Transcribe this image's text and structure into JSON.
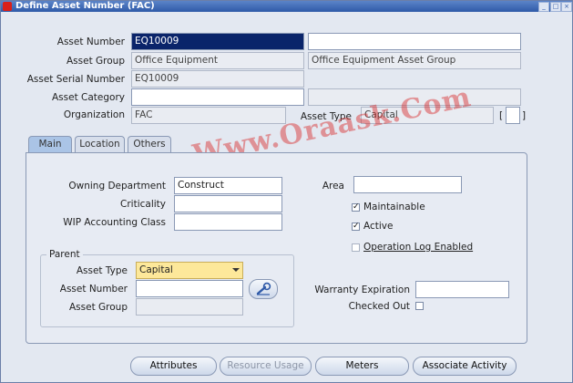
{
  "window": {
    "title": "Define Asset Number (FAC)"
  },
  "header": {
    "asset_number_label": "Asset Number",
    "asset_number_value": "EQ10009",
    "asset_group_label": "Asset Group",
    "asset_group_value": "Office Equipment",
    "asset_group_desc": "Office Equipment Asset Group",
    "asset_serial_label": "Asset Serial Number",
    "asset_serial_value": "EQ10009",
    "asset_category_label": "Asset Category",
    "organization_label": "Organization",
    "organization_value": "FAC",
    "asset_type_label": "Asset Type",
    "asset_type_value": "Capital",
    "bracket_open": "[",
    "bracket_close": "]"
  },
  "tabs": [
    {
      "label": "Main"
    },
    {
      "label": "Location"
    },
    {
      "label": "Others"
    }
  ],
  "main": {
    "owning_department_label": "Owning Department",
    "owning_department_value": "Construct",
    "criticality_label": "Criticality",
    "wip_label": "WIP Accounting Class",
    "area_label": "Area",
    "maintainable_label": "Maintainable",
    "active_label": "Active",
    "operation_log_label": "Operation Log Enabled",
    "warranty_label": "Warranty Expiration",
    "checked_out_label": "Checked Out"
  },
  "parent": {
    "group_label": "Parent",
    "asset_type_label": "Asset Type",
    "asset_type_value": "Capital",
    "asset_number_label": "Asset  Number",
    "asset_group_label": "Asset Group"
  },
  "buttons": {
    "attributes": "Attributes",
    "resource_usage": "Resource Usage",
    "meters": "Meters",
    "associate_activity": "Associate Activity"
  },
  "watermark": "Www.Oraask.Com",
  "colors": {
    "title_bar": "#2f5aa8",
    "watermark": "#d62828",
    "active_tab": "#aac4e6"
  }
}
